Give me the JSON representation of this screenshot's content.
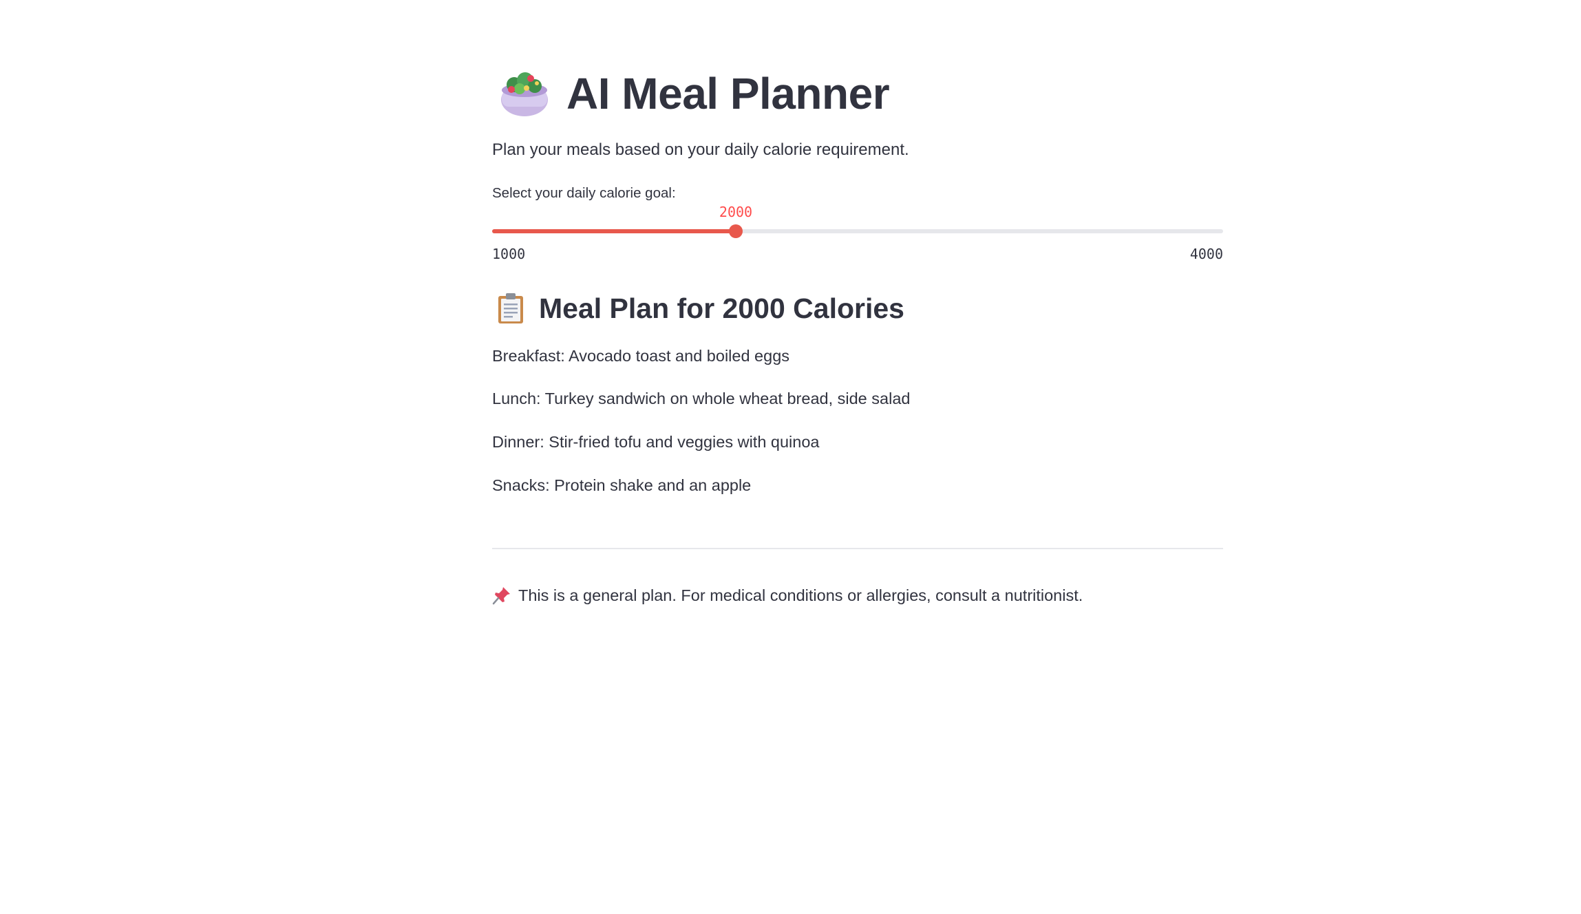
{
  "header": {
    "title": "AI Meal Planner",
    "title_icon": "salad-bowl-icon",
    "subtitle": "Plan your meals based on your daily calorie requirement."
  },
  "slider": {
    "label": "Select your daily calorie goal:",
    "value": "2000",
    "min": "1000",
    "max": "4000",
    "fraction": 0.3333,
    "accent_color": "#ff4b4b"
  },
  "plan": {
    "icon": "clipboard-icon",
    "title": "Meal Plan for 2000 Calories",
    "meals": [
      "Breakfast: Avocado toast and boiled eggs",
      "Lunch: Turkey sandwich on whole wheat bread, side salad",
      "Dinner: Stir-fried tofu and veggies with quinoa",
      "Snacks: Protein shake and an apple"
    ]
  },
  "footer": {
    "icon": "pushpin-icon",
    "note": "This is a general plan. For medical conditions or allergies, consult a nutritionist."
  }
}
